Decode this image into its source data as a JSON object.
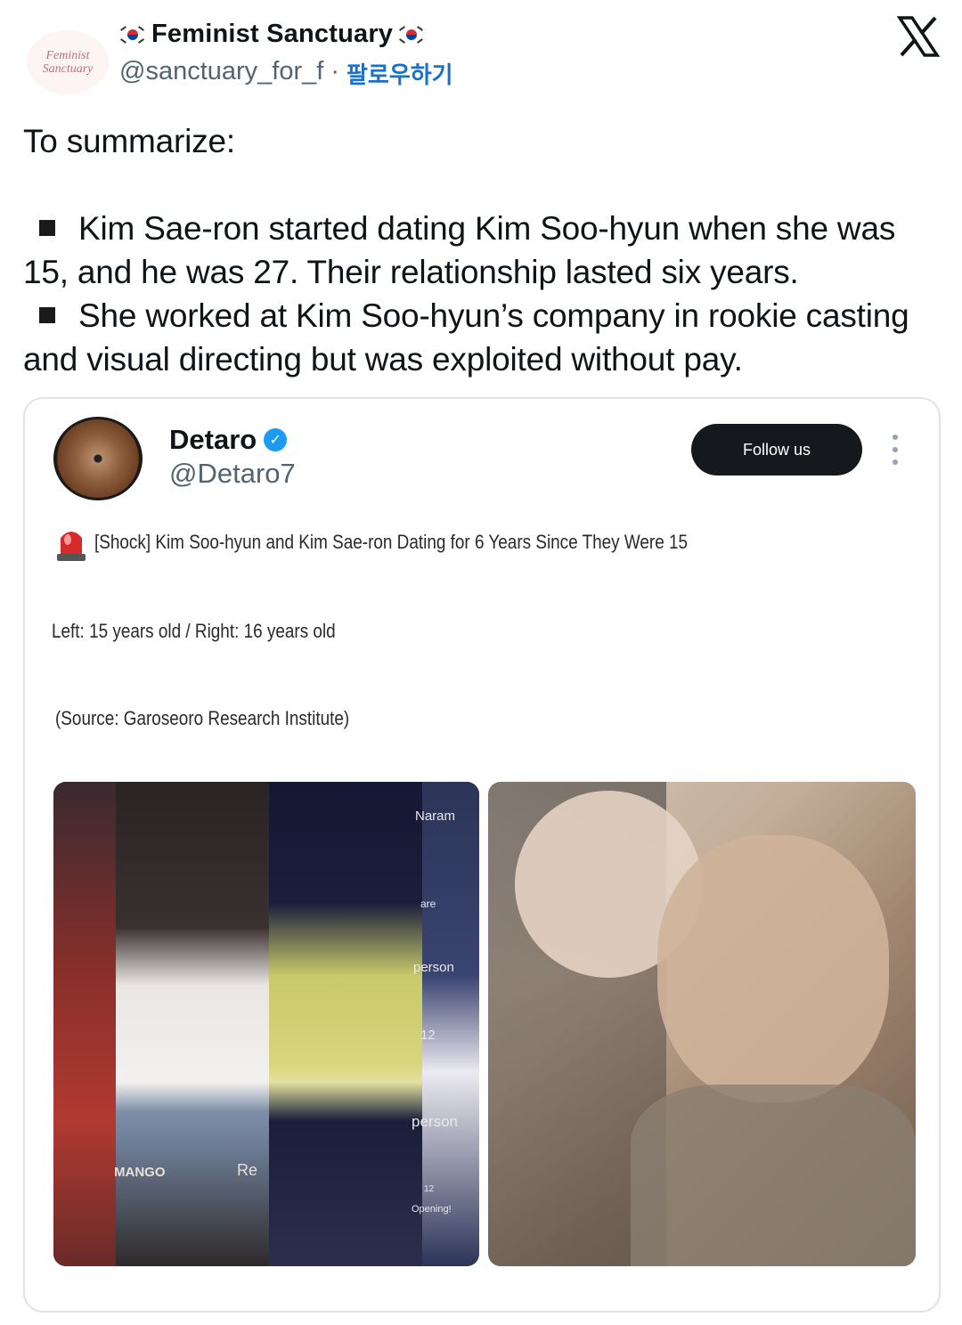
{
  "header": {
    "avatar_text_1": "Feminist",
    "avatar_text_2": "Sanctuary",
    "display_name": "Feminist Sanctuary",
    "handle": "@sanctuary_for_f",
    "separator": "·",
    "follow_label": "팔로우하기"
  },
  "tweet": {
    "line_intro": "To summarize:",
    "bullet_1": "Kim Sae-ron started dating Kim Soo-hyun when she was 15, and he was 27. Their relationship lasted six years.",
    "bullet_2": "She worked at Kim Soo-hyun’s company in rookie casting and visual directing but was exploited without pay."
  },
  "embedded": {
    "name": "Detaro",
    "handle": "@Detaro7",
    "follow_label": "Follow us",
    "headline": "[Shock] Kim Soo-hyun and Kim Sae-ron Dating for 6 Years Since They Were 15",
    "caption": "Left: 15 years old / Right: 16 years old",
    "source": "(Source: Garoseoro Research Institute)",
    "photo_texts": {
      "naram": "Naram",
      "are": "are",
      "person_1": "person",
      "num_12": "12",
      "person_2": "person",
      "num_12b": "12",
      "opening": "Opening!",
      "mango": "MANGO",
      "re": "Re"
    }
  },
  "colors": {
    "follow_link": "#1d70c9",
    "verified": "#1d9bf0",
    "follow_button_bg": "#15181c"
  }
}
